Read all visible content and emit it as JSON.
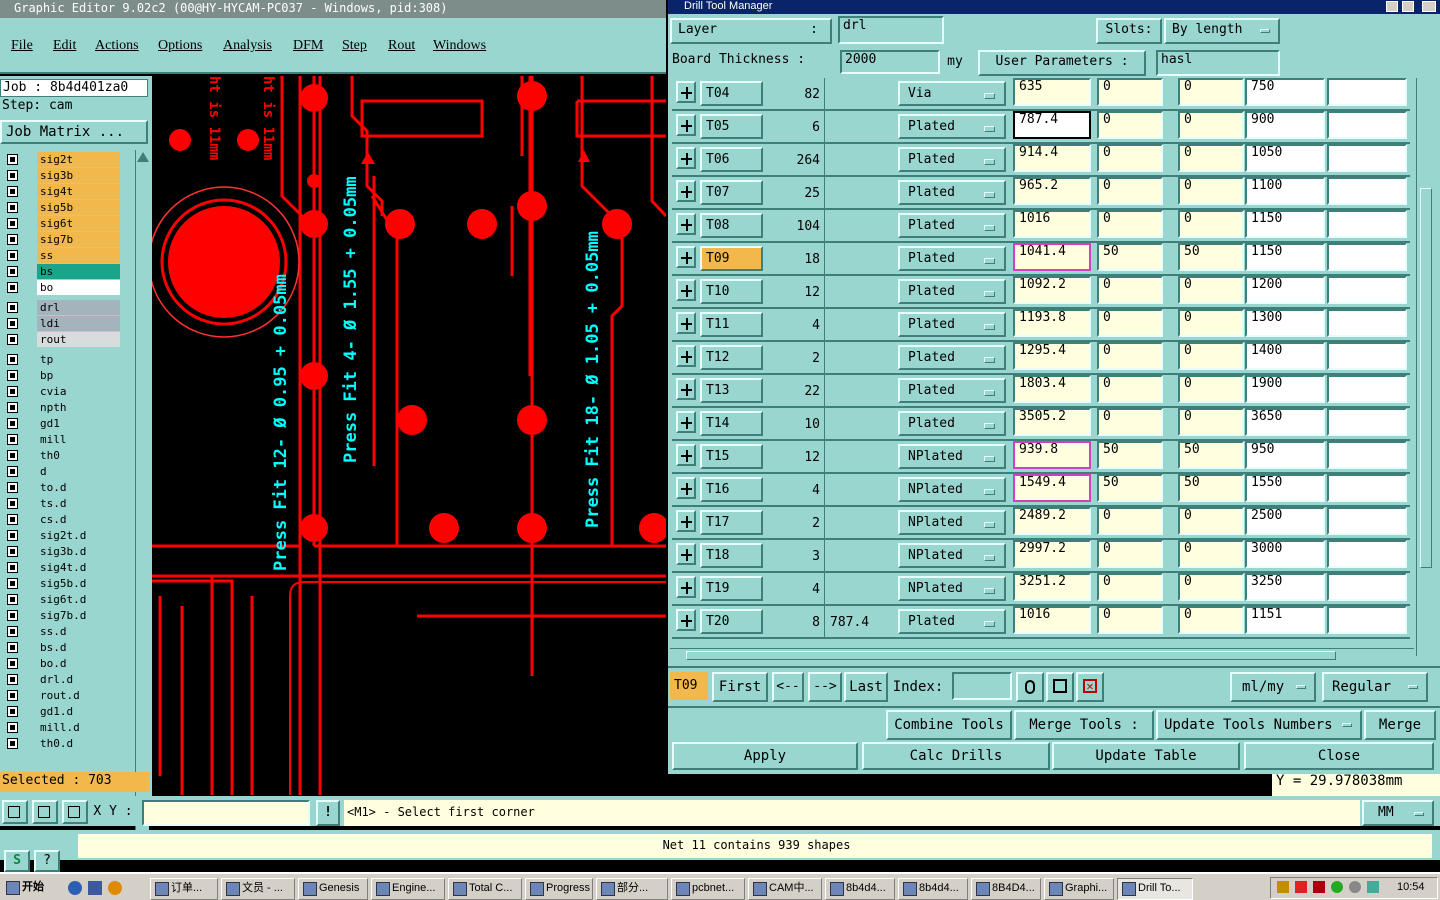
{
  "main_window": {
    "title": "Graphic Editor 9.02c2 (00@HY-HYCAM-PC037 - Windows, pid:308)",
    "menu": [
      "File",
      "Edit",
      "Actions",
      "Options",
      "Analysis",
      "DFM",
      "Step",
      "Rout",
      "Windows"
    ]
  },
  "left_panel": {
    "job": "Job : 8b4d401za0",
    "step": "Step: cam",
    "job_matrix": "Job Matrix ...",
    "layer_groups": [
      [
        {
          "name": "sig2t",
          "color": "#f2b84b"
        },
        {
          "name": "sig3b",
          "color": "#f2b84b"
        },
        {
          "name": "sig4t",
          "color": "#f2b84b"
        },
        {
          "name": "sig5b",
          "color": "#f2b84b"
        },
        {
          "name": "sig6t",
          "color": "#f2b84b"
        },
        {
          "name": "sig7b",
          "color": "#f2b84b"
        },
        {
          "name": "ss",
          "color": "#f2b84b"
        },
        {
          "name": "bs",
          "color": "#18a589"
        },
        {
          "name": "bo",
          "color": "#ffffff"
        }
      ],
      [
        {
          "name": "drl",
          "color": "#a4b4bd"
        },
        {
          "name": "ldi",
          "color": "#a4b4bd"
        },
        {
          "name": "rout",
          "color": "#d8dcdc"
        }
      ],
      [
        {
          "name": "tp",
          "color": "#99d6d0"
        },
        {
          "name": "bp",
          "color": "#99d6d0"
        },
        {
          "name": "cvia",
          "color": "#99d6d0"
        },
        {
          "name": "npth",
          "color": "#99d6d0"
        },
        {
          "name": "gd1",
          "color": "#99d6d0"
        },
        {
          "name": "mill",
          "color": "#99d6d0"
        },
        {
          "name": "th0",
          "color": "#99d6d0"
        },
        {
          "name": "d",
          "color": "#99d6d0"
        },
        {
          "name": "to.d",
          "color": "#99d6d0"
        },
        {
          "name": "ts.d",
          "color": "#99d6d0"
        },
        {
          "name": "cs.d",
          "color": "#99d6d0"
        },
        {
          "name": "sig2t.d",
          "color": "#99d6d0"
        },
        {
          "name": "sig3b.d",
          "color": "#99d6d0"
        },
        {
          "name": "sig4t.d",
          "color": "#99d6d0"
        },
        {
          "name": "sig5b.d",
          "color": "#99d6d0"
        },
        {
          "name": "sig6t.d",
          "color": "#99d6d0"
        },
        {
          "name": "sig7b.d",
          "color": "#99d6d0"
        },
        {
          "name": "ss.d",
          "color": "#99d6d0"
        },
        {
          "name": "bs.d",
          "color": "#99d6d0"
        },
        {
          "name": "bo.d",
          "color": "#99d6d0"
        },
        {
          "name": "drl.d",
          "color": "#99d6d0"
        },
        {
          "name": "rout.d",
          "color": "#99d6d0"
        },
        {
          "name": "gd1.d",
          "color": "#99d6d0"
        },
        {
          "name": "mill.d",
          "color": "#99d6d0"
        },
        {
          "name": "th0.d",
          "color": "#99d6d0"
        }
      ]
    ],
    "selected": "Selected : 703"
  },
  "canvas": {
    "annotations": [
      "Press Fit 12- Ø 0.95 + 0.05mm",
      "Press Fit 4- Ø 1.55 + 0.05mm",
      "Press Fit 18- Ø 1.05 + 0.05mm"
    ],
    "top_text": [
      "ht is 11mm",
      "ht is 11mm"
    ]
  },
  "drill_tool_manager": {
    "title": "Drill Tool Manager",
    "layer_label": "Layer",
    "layer_value": "drl",
    "slots_label": "Slots:",
    "slots_value": "By length",
    "board_thickness_label": "Board Thickness :",
    "board_thickness_value": "2000",
    "board_thickness_unit": "my",
    "user_params_label": "User Parameters :",
    "user_params_value": "hasl",
    "rows": [
      {
        "tool": "T04",
        "count": "82",
        "finish": "",
        "type": "Via",
        "drill": "635",
        "p1": "0",
        "p2": "0",
        "size": "750",
        "extra": "",
        "hl": false,
        "sel": false
      },
      {
        "tool": "T05",
        "count": "6",
        "finish": "",
        "type": "Plated",
        "drill": "787.4",
        "p1": "0",
        "p2": "0",
        "size": "900",
        "extra": "",
        "hl": false,
        "sel": false
      },
      {
        "tool": "T06",
        "count": "264",
        "finish": "",
        "type": "Plated",
        "drill": "914.4",
        "p1": "0",
        "p2": "0",
        "size": "1050",
        "extra": "",
        "hl": false,
        "sel": false
      },
      {
        "tool": "T07",
        "count": "25",
        "finish": "",
        "type": "Plated",
        "drill": "965.2",
        "p1": "0",
        "p2": "0",
        "size": "1100",
        "extra": "",
        "hl": false,
        "sel": false
      },
      {
        "tool": "T08",
        "count": "104",
        "finish": "",
        "type": "Plated",
        "drill": "1016",
        "p1": "0",
        "p2": "0",
        "size": "1150",
        "extra": "",
        "hl": false,
        "sel": false
      },
      {
        "tool": "T09",
        "count": "18",
        "finish": "",
        "type": "Plated",
        "drill": "1041.4",
        "p1": "50",
        "p2": "50",
        "size": "1150",
        "extra": "",
        "hl": true,
        "sel": true
      },
      {
        "tool": "T10",
        "count": "12",
        "finish": "",
        "type": "Plated",
        "drill": "1092.2",
        "p1": "0",
        "p2": "0",
        "size": "1200",
        "extra": "",
        "hl": false,
        "sel": false
      },
      {
        "tool": "T11",
        "count": "4",
        "finish": "",
        "type": "Plated",
        "drill": "1193.8",
        "p1": "0",
        "p2": "0",
        "size": "1300",
        "extra": "",
        "hl": false,
        "sel": false
      },
      {
        "tool": "T12",
        "count": "2",
        "finish": "",
        "type": "Plated",
        "drill": "1295.4",
        "p1": "0",
        "p2": "0",
        "size": "1400",
        "extra": "",
        "hl": false,
        "sel": false
      },
      {
        "tool": "T13",
        "count": "22",
        "finish": "",
        "type": "Plated",
        "drill": "1803.4",
        "p1": "0",
        "p2": "0",
        "size": "1900",
        "extra": "",
        "hl": false,
        "sel": false
      },
      {
        "tool": "T14",
        "count": "10",
        "finish": "",
        "type": "Plated",
        "drill": "3505.2",
        "p1": "0",
        "p2": "0",
        "size": "3650",
        "extra": "",
        "hl": false,
        "sel": false
      },
      {
        "tool": "T15",
        "count": "12",
        "finish": "",
        "type": "NPlated",
        "drill": "939.8",
        "p1": "50",
        "p2": "50",
        "size": "950",
        "extra": "",
        "hl": true,
        "sel": false
      },
      {
        "tool": "T16",
        "count": "4",
        "finish": "",
        "type": "NPlated",
        "drill": "1549.4",
        "p1": "50",
        "p2": "50",
        "size": "1550",
        "extra": "",
        "hl": true,
        "sel": false
      },
      {
        "tool": "T17",
        "count": "2",
        "finish": "",
        "type": "NPlated",
        "drill": "2489.2",
        "p1": "0",
        "p2": "0",
        "size": "2500",
        "extra": "",
        "hl": false,
        "sel": false
      },
      {
        "tool": "T18",
        "count": "3",
        "finish": "",
        "type": "NPlated",
        "drill": "2997.2",
        "p1": "0",
        "p2": "0",
        "size": "3000",
        "extra": "",
        "hl": false,
        "sel": false
      },
      {
        "tool": "T19",
        "count": "4",
        "finish": "",
        "type": "NPlated",
        "drill": "3251.2",
        "p1": "0",
        "p2": "0",
        "size": "3250",
        "extra": "",
        "hl": false,
        "sel": false
      },
      {
        "tool": "T20",
        "count": "8",
        "finish": "787.4",
        "type": "Plated",
        "drill": "1016",
        "p1": "0",
        "p2": "0",
        "size": "1151",
        "extra": "",
        "hl": false,
        "sel": false
      }
    ],
    "nav": {
      "current": "T09",
      "first": "First",
      "prev": "<--",
      "next": "-->",
      "last": "Last",
      "index_label": "Index:",
      "index_value": "",
      "units": "ml/my",
      "mode": "Regular"
    },
    "combine_tools": "Combine Tools",
    "merge_tools_label": "Merge Tools :",
    "update_tools_numbers": "Update Tools Numbers",
    "merge": "Merge",
    "apply": "Apply",
    "calc_drills": "Calc Drills",
    "update_table": "Update Table",
    "close": "Close"
  },
  "status": {
    "y_coord": "Y = 29.978038mm",
    "xy_label": "X Y :",
    "xy_value": "",
    "prompt": "<M1> - Select first corner",
    "units": "MM",
    "net_message": "Net 11 contains 939 shapes"
  },
  "taskbar": {
    "start": "开始",
    "tasks": [
      "订单...",
      "文员 - ...",
      "Genesis",
      "Engine...",
      "Total C...",
      "Progress",
      "部分...",
      "pcbnet...",
      "CAM中...",
      "8b4d4...",
      "8b4d4...",
      "8B4D4...",
      "Graphi...",
      "Drill To..."
    ],
    "clock": "10:54"
  }
}
